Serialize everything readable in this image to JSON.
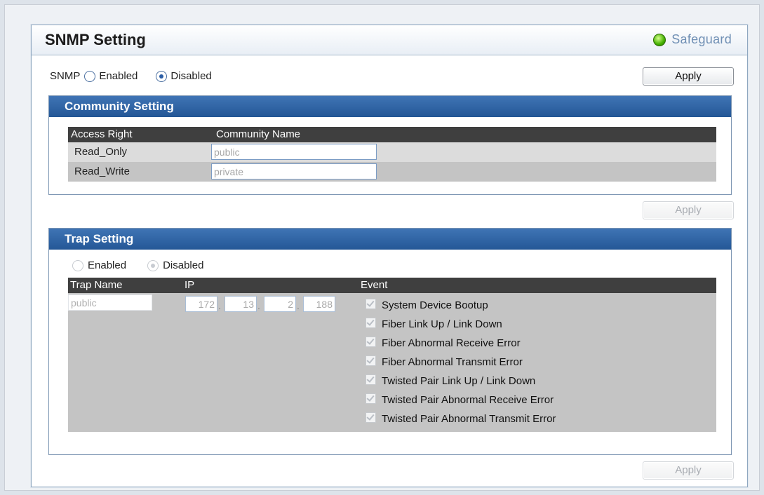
{
  "header": {
    "title": "SNMP Setting",
    "safeguard_label": "Safeguard"
  },
  "snmp": {
    "label": "SNMP",
    "enabled_label": "Enabled",
    "disabled_label": "Disabled",
    "selected": "Disabled",
    "apply_label": "Apply"
  },
  "community": {
    "title": "Community Setting",
    "col_access": "Access Right",
    "col_name": "Community Name",
    "rows": [
      {
        "access": "Read_Only",
        "name": "public"
      },
      {
        "access": "Read_Write",
        "name": "private"
      }
    ],
    "apply_label": "Apply"
  },
  "trap": {
    "title": "Trap Setting",
    "enabled_label": "Enabled",
    "disabled_label": "Disabled",
    "selected": "Disabled",
    "col_name": "Trap Name",
    "col_ip": "IP",
    "col_event": "Event",
    "trap_name": "public",
    "ip": [
      "172",
      "13",
      "2",
      "188"
    ],
    "events": [
      "System Device Bootup",
      "Fiber Link Up / Link Down",
      "Fiber Abnormal Receive Error",
      "Fiber Abnormal Transmit Error",
      "Twisted Pair Link Up / Link Down",
      "Twisted Pair Abnormal Receive Error",
      "Twisted Pair Abnormal Transmit Error"
    ],
    "apply_label": "Apply"
  },
  "colors": {
    "section_header": "#2d63a4",
    "table_header": "#3f3f3f",
    "led_green": "#44b000"
  }
}
